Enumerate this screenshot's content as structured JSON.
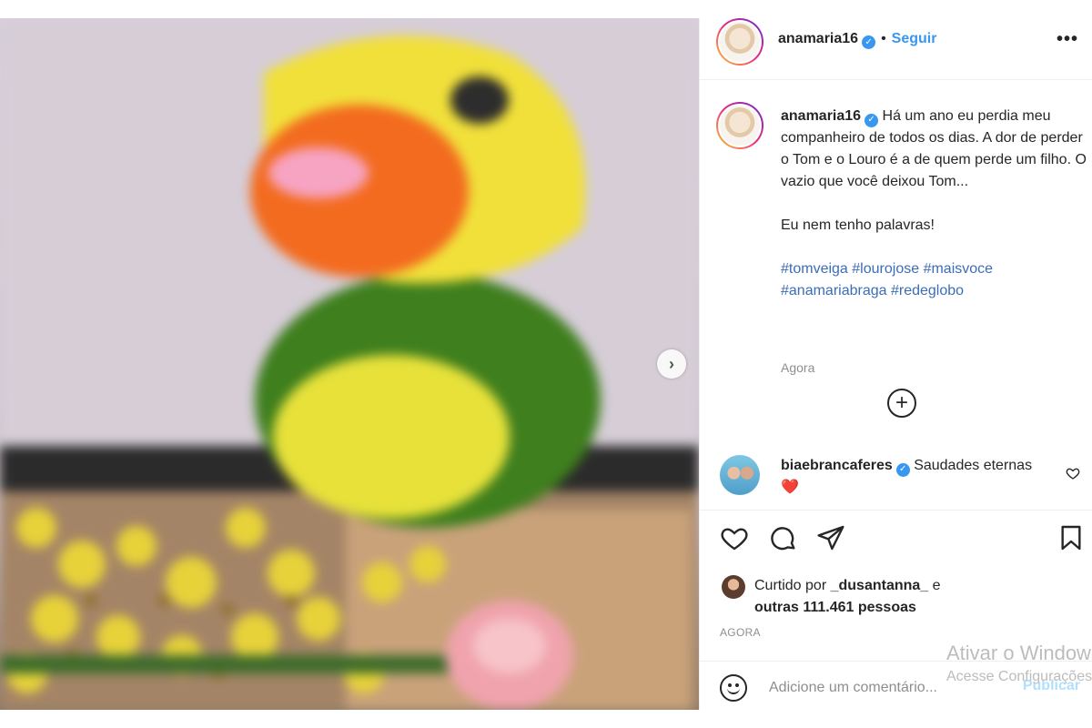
{
  "post": {
    "username": "anamaria16",
    "follow_label": "Seguir",
    "separator": "•",
    "more_label": "•••",
    "caption_lines": [
      "Há um ano eu perdia meu companheiro de todos os dias. A dor de perder o Tom e o Louro é a de quem perde um filho. O vazio que você deixou Tom...",
      "Eu nem tenho palavras!"
    ],
    "hashtags": [
      "#tomveiga",
      "#lourojose",
      "#maisvoce",
      "#anamariabraga",
      "#redeglobo"
    ],
    "caption_time": "Agora",
    "load_more_icon": "plus-circle-icon"
  },
  "comment": {
    "username": "biaebrancaferes",
    "text": "Saudades eternas",
    "emoji": "❤️"
  },
  "likes": {
    "prefix": "Curtido por",
    "liker": "_dusantanna_",
    "connector": "e",
    "others": "outras 111.461 pessoas"
  },
  "post_time": "AGORA",
  "add_comment": {
    "placeholder": "Adicione um comentário...",
    "publish_label": "Publicar"
  },
  "watermark": {
    "line1": "Ativar o Windows",
    "line2": "Acesse Configurações"
  },
  "colors": {
    "link_blue": "#3897f0",
    "hashtag_blue": "#3b6db8",
    "publish_disabled": "#b2dffc"
  }
}
